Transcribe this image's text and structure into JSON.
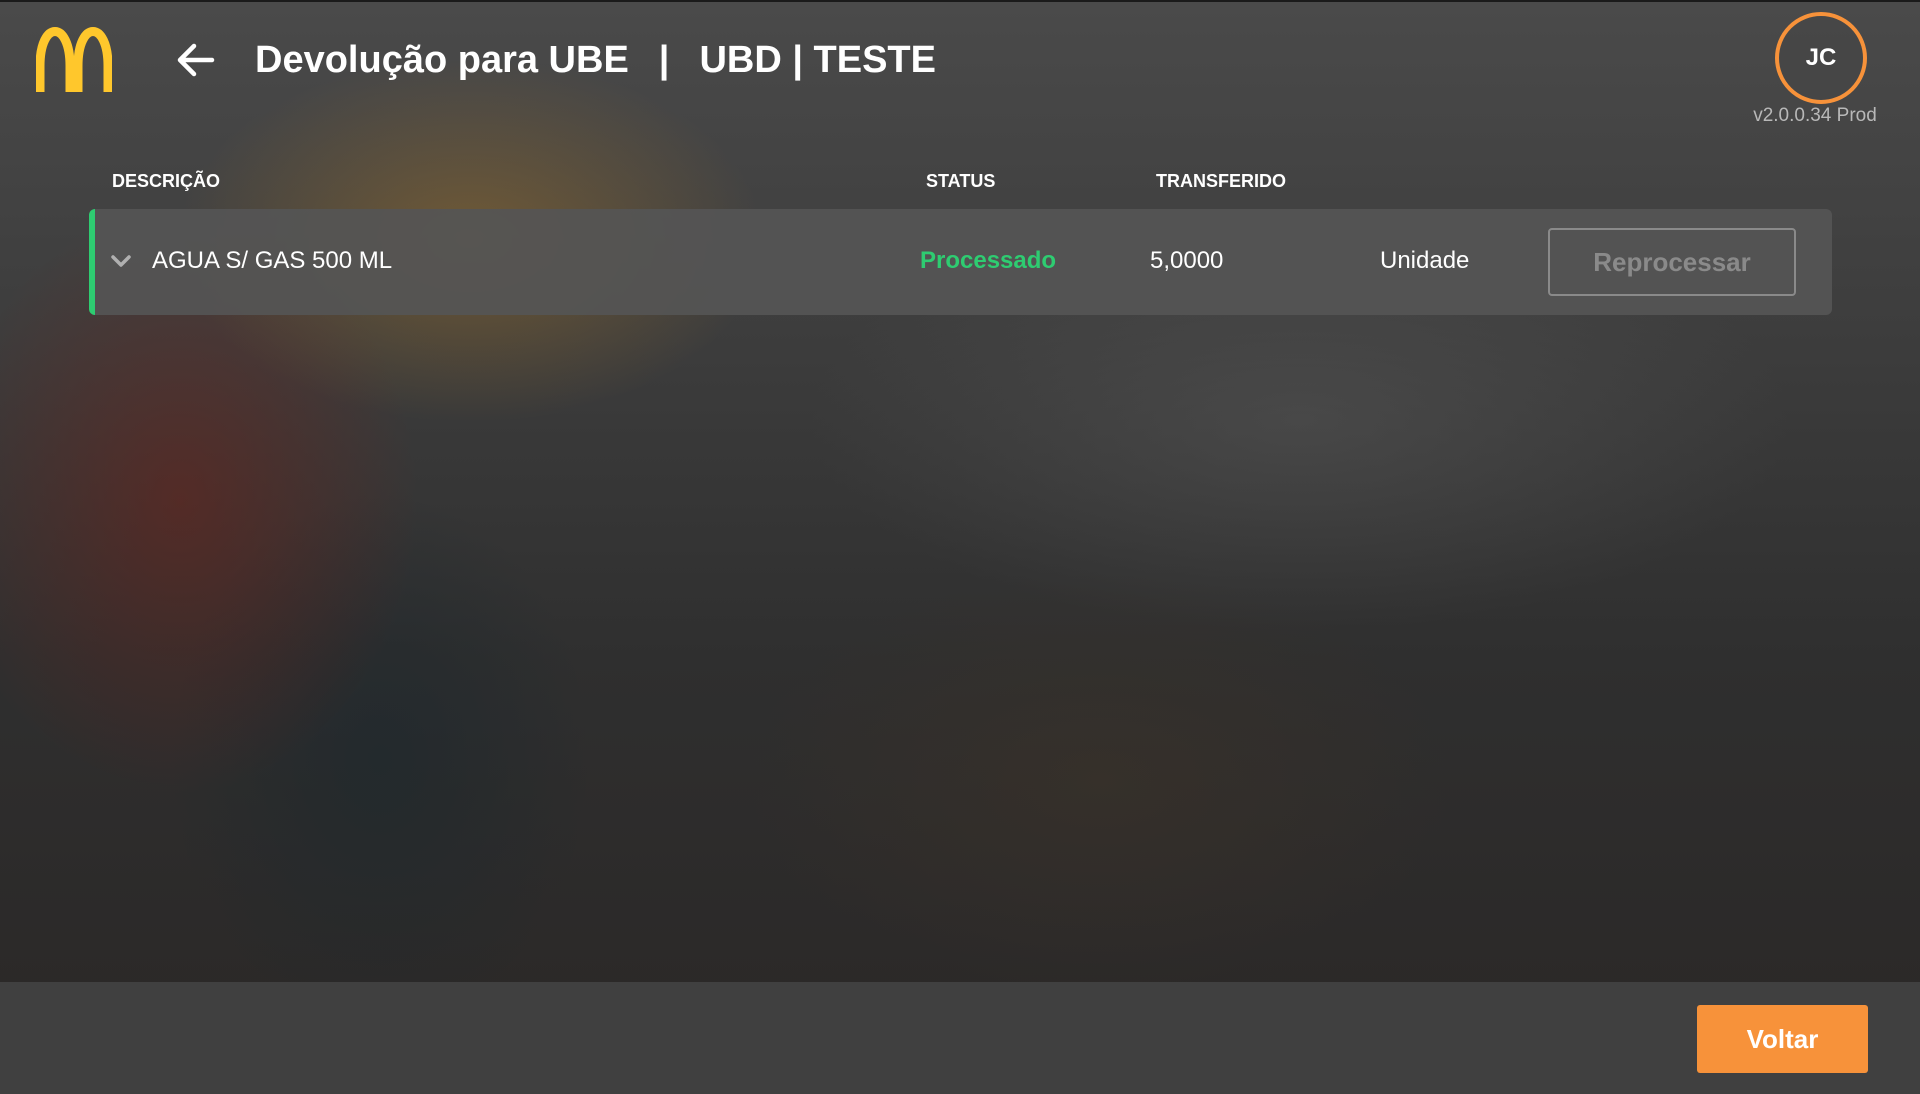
{
  "header": {
    "title": "Devolução para UBE",
    "separator": "|",
    "subtitle": "UBD | TESTE",
    "avatar_initials": "JC",
    "version": "v2.0.0.34 Prod"
  },
  "table": {
    "columns": {
      "description": "DESCRIÇÃO",
      "status": "STATUS",
      "transferred": "TRANSFERIDO"
    },
    "rows": [
      {
        "description": "AGUA S/ GAS 500 ML",
        "status": "Processado",
        "transferred": "5,0000",
        "unit": "Unidade",
        "action_label": "Reprocessar"
      }
    ]
  },
  "footer": {
    "back_label": "Voltar"
  },
  "icons": {
    "logo": "mcdonalds-logo",
    "back": "arrow-left-icon",
    "expand": "chevron-down-icon"
  },
  "colors": {
    "accent": "#f7923a",
    "logo": "#ffc72c",
    "status_ok": "#2ecc71",
    "footer_bg": "#404040",
    "row_bg": "#555555"
  }
}
